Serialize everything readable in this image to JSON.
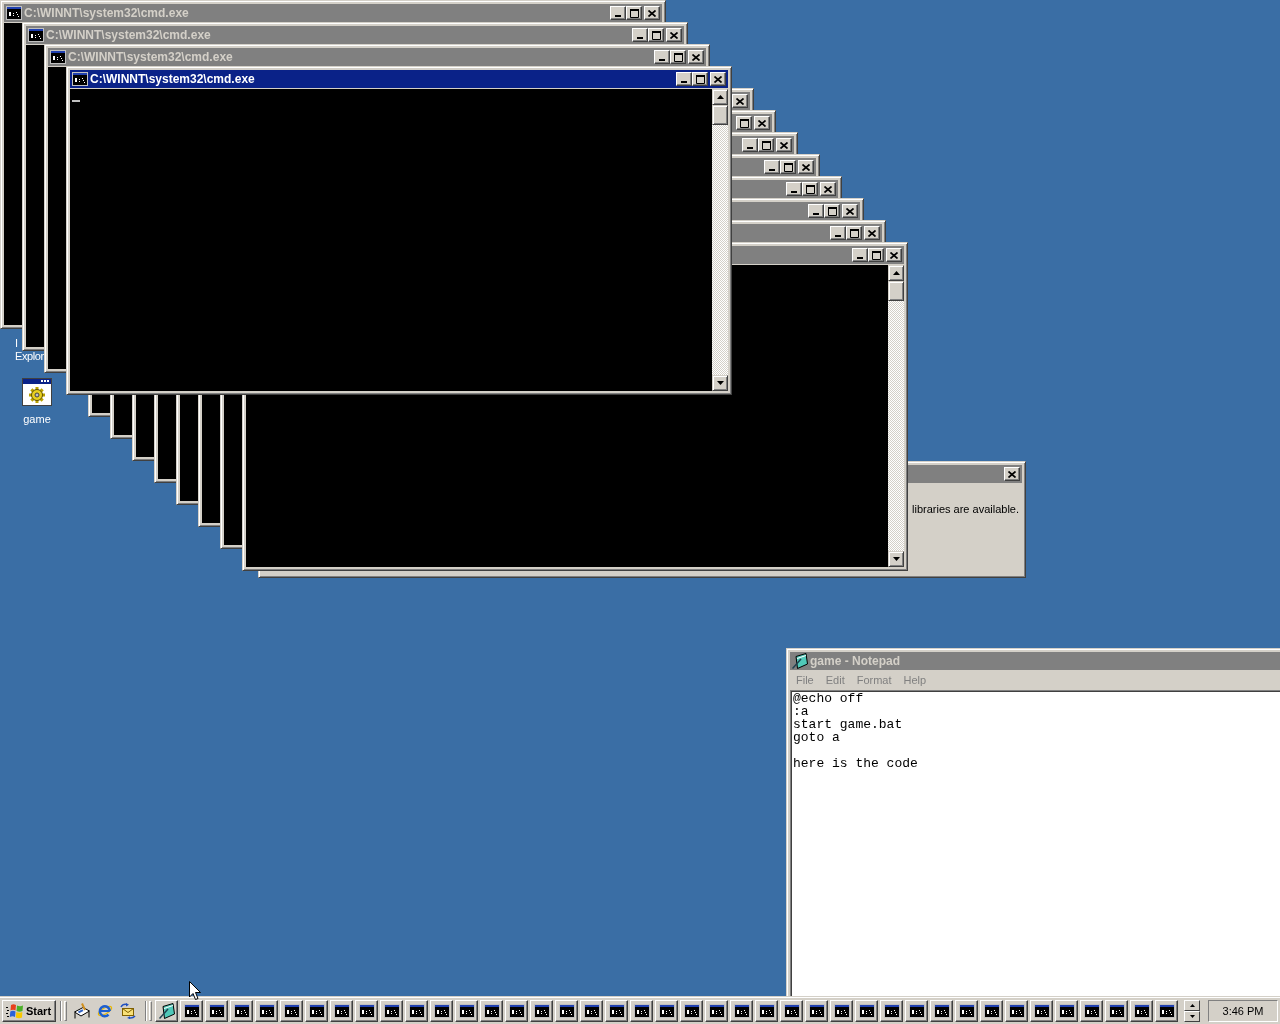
{
  "console_windows": [
    {
      "title": "C:\\WINNT\\system32\\cmd.exe",
      "active": false,
      "buttons": [
        {
          "kind": "minimize"
        },
        {
          "kind": "maximize"
        },
        {
          "kind": "close"
        }
      ]
    },
    {
      "title": "C:\\WINNT\\system32\\cmd.exe",
      "active": false,
      "buttons": [
        {
          "kind": "minimize"
        },
        {
          "kind": "maximize"
        },
        {
          "kind": "close"
        }
      ]
    },
    {
      "title": "C:\\WINNT\\system32\\cmd.exe",
      "active": false,
      "buttons": [
        {
          "kind": "minimize"
        },
        {
          "kind": "maximize"
        },
        {
          "kind": "close"
        }
      ]
    },
    {
      "title": "C:\\WINNT\\system32\\cmd.exe",
      "active": true,
      "buttons": [
        {
          "kind": "minimize"
        },
        {
          "kind": "maximize"
        },
        {
          "kind": "close"
        }
      ],
      "scrollbar": true
    },
    {
      "active": false,
      "buttons": [
        {
          "kind": "close"
        }
      ]
    },
    {
      "active": false,
      "buttons": [
        {
          "kind": "maximize"
        },
        {
          "kind": "close"
        }
      ]
    },
    {
      "active": false,
      "buttons": [
        {
          "kind": "minimize"
        },
        {
          "kind": "maximize"
        },
        {
          "kind": "close"
        }
      ]
    },
    {
      "active": false,
      "buttons": [
        {
          "kind": "minimize"
        },
        {
          "kind": "maximize"
        },
        {
          "kind": "close"
        }
      ]
    },
    {
      "active": false,
      "buttons": [
        {
          "kind": "minimize"
        },
        {
          "kind": "maximize"
        },
        {
          "kind": "close"
        }
      ]
    },
    {
      "active": false,
      "buttons": [
        {
          "kind": "minimize"
        },
        {
          "kind": "maximize"
        },
        {
          "kind": "close"
        }
      ]
    },
    {
      "active": false,
      "buttons": [
        {
          "kind": "minimize"
        },
        {
          "kind": "maximize"
        },
        {
          "kind": "close"
        }
      ]
    },
    {
      "active": false,
      "buttons": [
        {
          "kind": "minimize"
        },
        {
          "kind": "maximize"
        },
        {
          "kind": "close"
        }
      ],
      "scrollbar": true
    }
  ],
  "dialog": {
    "active": false,
    "buttons": [
      {
        "kind": "close"
      }
    ],
    "message": "libraries are available."
  },
  "notepad": {
    "title": "game - Notepad",
    "active": false,
    "menu": [
      {
        "label": "File",
        "disabled": true
      },
      {
        "label": "Edit",
        "disabled": true
      },
      {
        "label": "Format",
        "disabled": true
      },
      {
        "label": "Help",
        "disabled": true
      }
    ],
    "text": "@echo off\n:a\nstart game.bat\ngoto a\n\nhere is the code"
  },
  "desktop_icons": [
    {
      "kind": "covered",
      "label_lines": [
        "I",
        "Explor"
      ]
    },
    {
      "kind": "batch_file",
      "label_lines": [
        "game"
      ]
    }
  ],
  "taskbar": {
    "start_label": "Start",
    "quick_launch": [
      {
        "kind": "desktop"
      },
      {
        "kind": "browser"
      },
      {
        "kind": "mail"
      }
    ],
    "tasks": [
      {
        "kind": "notepad"
      },
      {
        "kind": "console"
      },
      {
        "kind": "console"
      },
      {
        "kind": "console"
      },
      {
        "kind": "console"
      },
      {
        "kind": "console"
      },
      {
        "kind": "console"
      },
      {
        "kind": "console"
      },
      {
        "kind": "console"
      },
      {
        "kind": "console"
      },
      {
        "kind": "console"
      },
      {
        "kind": "console"
      },
      {
        "kind": "console"
      },
      {
        "kind": "console"
      },
      {
        "kind": "console"
      },
      {
        "kind": "console"
      },
      {
        "kind": "console"
      },
      {
        "kind": "console"
      },
      {
        "kind": "console"
      },
      {
        "kind": "console"
      },
      {
        "kind": "console"
      },
      {
        "kind": "console"
      },
      {
        "kind": "console"
      },
      {
        "kind": "console"
      },
      {
        "kind": "console"
      },
      {
        "kind": "console"
      },
      {
        "kind": "console"
      },
      {
        "kind": "console"
      },
      {
        "kind": "console"
      },
      {
        "kind": "console"
      },
      {
        "kind": "console"
      },
      {
        "kind": "console"
      },
      {
        "kind": "console"
      },
      {
        "kind": "console"
      },
      {
        "kind": "console"
      },
      {
        "kind": "console"
      },
      {
        "kind": "console"
      },
      {
        "kind": "console"
      },
      {
        "kind": "console"
      },
      {
        "kind": "console"
      },
      {
        "kind": "console"
      }
    ],
    "clock": "3:46 PM"
  }
}
